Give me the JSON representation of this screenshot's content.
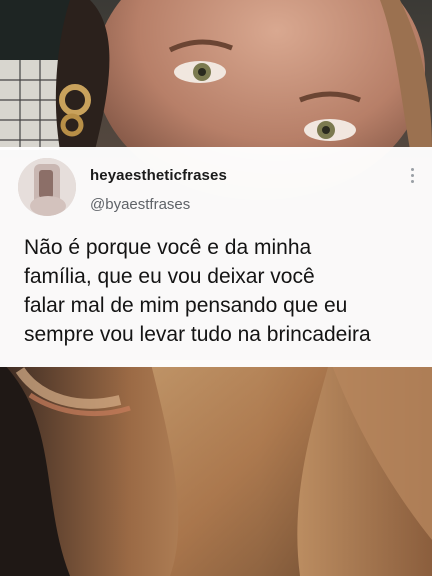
{
  "post": {
    "display_name": "heyaestheticfrases",
    "handle": "@byaestfrases",
    "text": "Não é porque você e da minha\nfamília, que eu vou deixar você\nfalar mal de mim pensando que eu\nsempre vou levar tudo na brincadeira",
    "avatar_icon": "profile-photo",
    "menu_icon": "more-vertical-icon"
  },
  "background": {
    "icon": "selfie-photo"
  },
  "colors": {
    "card": "#ffffff",
    "name": "#1b1b1b",
    "handle": "#5f6368",
    "text": "#141414"
  }
}
